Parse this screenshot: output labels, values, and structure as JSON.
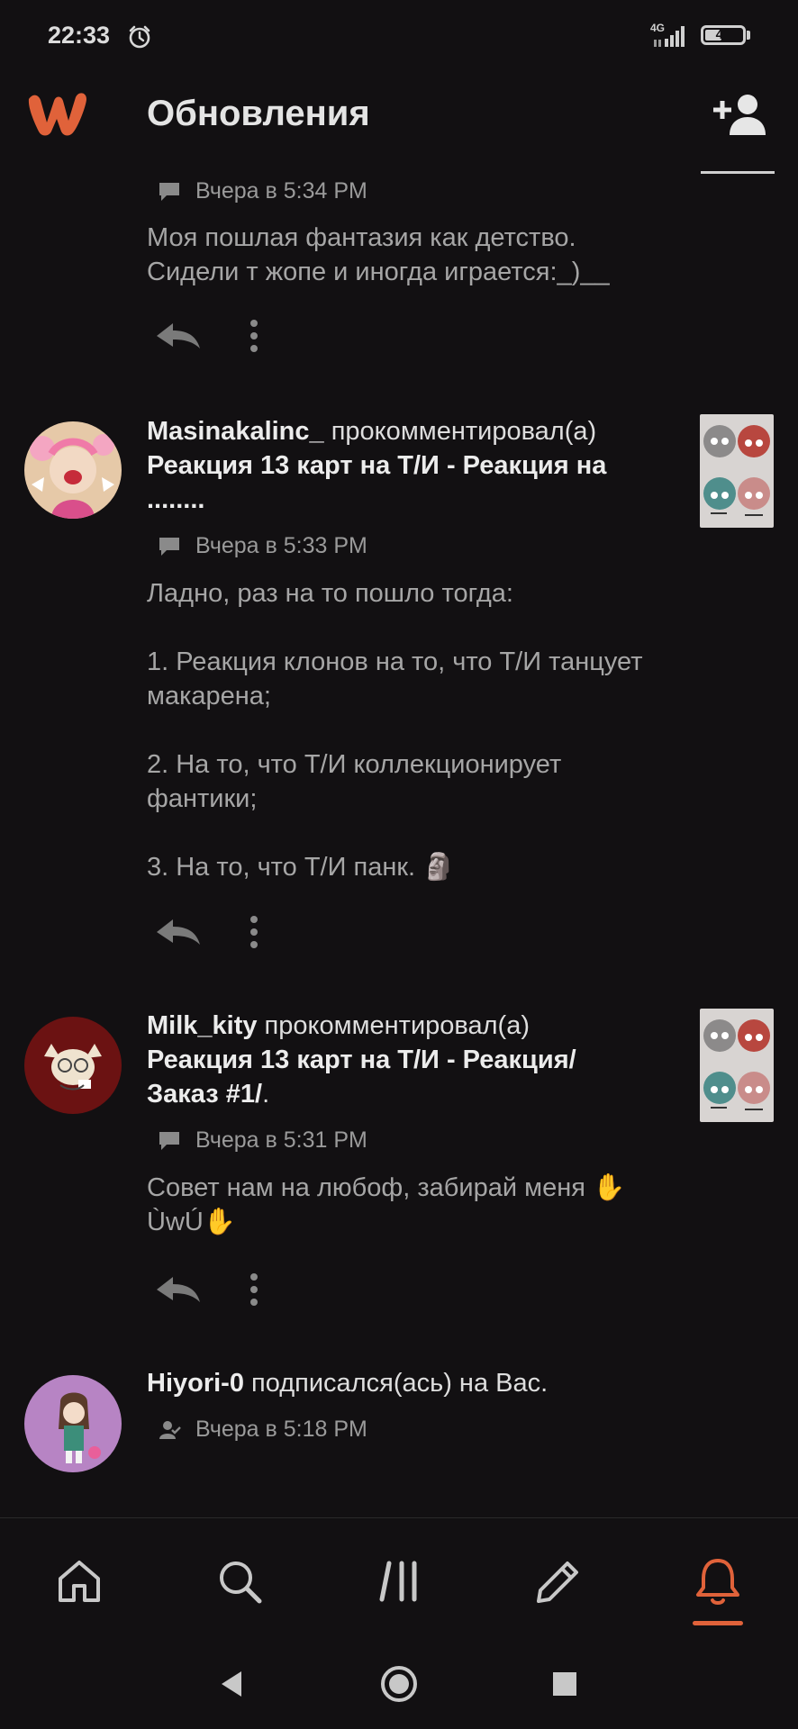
{
  "status_bar": {
    "time": "22:33",
    "network": "4G",
    "battery": "41",
    "battery_level": 0.41
  },
  "header": {
    "title": "Обновления"
  },
  "feed": [
    {
      "timestamp": "Вчера в 5:34 PM",
      "text": "Моя пошлая фантазия как детство.\nСидели т жопе и иногда играется:_)__"
    },
    {
      "user": "Masinakalinc_",
      "action": " прокомментировал(а)",
      "story": "Реакция 13 карт на Т/И - Реакция на ........",
      "timestamp": "Вчера в 5:33 PM",
      "text": "Ладно, раз на то пошло тогда:\n\n1. Реакция клонов на то, что Т/И танцует макарена;\n\n2. На то, что Т/И коллекционирует фантики;\n\n3.  На то, что Т/И панк. 🗿"
    },
    {
      "user": "Milk_kity",
      "action": " прокомментировал(а)",
      "story": "Реакция 13 карт на Т/И - Реакция/ Заказ #1/",
      "story_end": ".",
      "timestamp": "Вчера в 5:31 PM",
      "text": "Совет нам на любоф, забирай меня ✋ÙwÚ✋"
    },
    {
      "user": "Hiyori-0",
      "action": " подписался(ась) на Вас.",
      "timestamp": "Вчера в 5:18 PM"
    }
  ],
  "icons": {
    "alarm": "alarm-clock-icon",
    "signal": "signal-icon",
    "logo": "wattpad-logo",
    "add_user": "add-user-icon",
    "comment": "comment-icon",
    "follow": "follow-icon",
    "reply": "reply-icon",
    "more": "more-vertical-icon",
    "home": "home-icon",
    "search": "search-icon",
    "library": "library-icon",
    "write": "pencil-icon",
    "notifications": "bell-icon"
  },
  "colors": {
    "accent": "#e0623a",
    "background": "#121012",
    "text": "#dedede",
    "muted": "#a6a6a6"
  },
  "bottom_nav": {
    "active": "notifications"
  }
}
